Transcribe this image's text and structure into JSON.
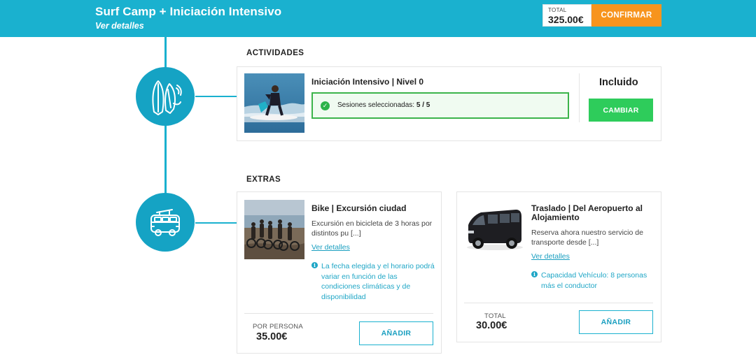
{
  "header": {
    "title": "Surf Camp + Iniciación Intensivo",
    "details_link": "Ver detalles",
    "total_label": "TOTAL",
    "total_value": "325.00€",
    "confirm_label": "CONFIRMAR"
  },
  "activities": {
    "section_title": "ACTIVIDADES",
    "icon": "surfboards-icon",
    "card": {
      "title": "Iniciación Intensivo | Nivel 0",
      "sessions_label": "Sesiones seleccionadas:",
      "sessions_value": "5 / 5",
      "status": "Incluido",
      "change_label": "CAMBIAR"
    }
  },
  "extras": {
    "section_title": "EXTRAS",
    "icon": "van-icon",
    "items": [
      {
        "title": "Bike | Excursión ciudad",
        "description": "Excursión en bicicleta de 3 horas por distintos pu [...]",
        "details_link": "Ver detalles",
        "note": "La fecha elegida y el horario podrá variar en función de las condiciones climáticas y de disponibilidad",
        "price_label": "POR PERSONA",
        "price": "35.00€",
        "add_label": "AÑADIR"
      },
      {
        "title": "Traslado | Del Aeropuerto al Alojamiento",
        "description": "Reserva ahora nuestro servicio de transporte desde [...]",
        "details_link": "Ver detalles",
        "note": "Capacidad Vehículo: 8 personas más el conductor",
        "price_label": "TOTAL",
        "price": "30.00€",
        "add_label": "AÑADIR"
      }
    ]
  },
  "colors": {
    "brand": "#1ab1cf",
    "confirm": "#f7941d",
    "success": "#2ecc5b"
  }
}
